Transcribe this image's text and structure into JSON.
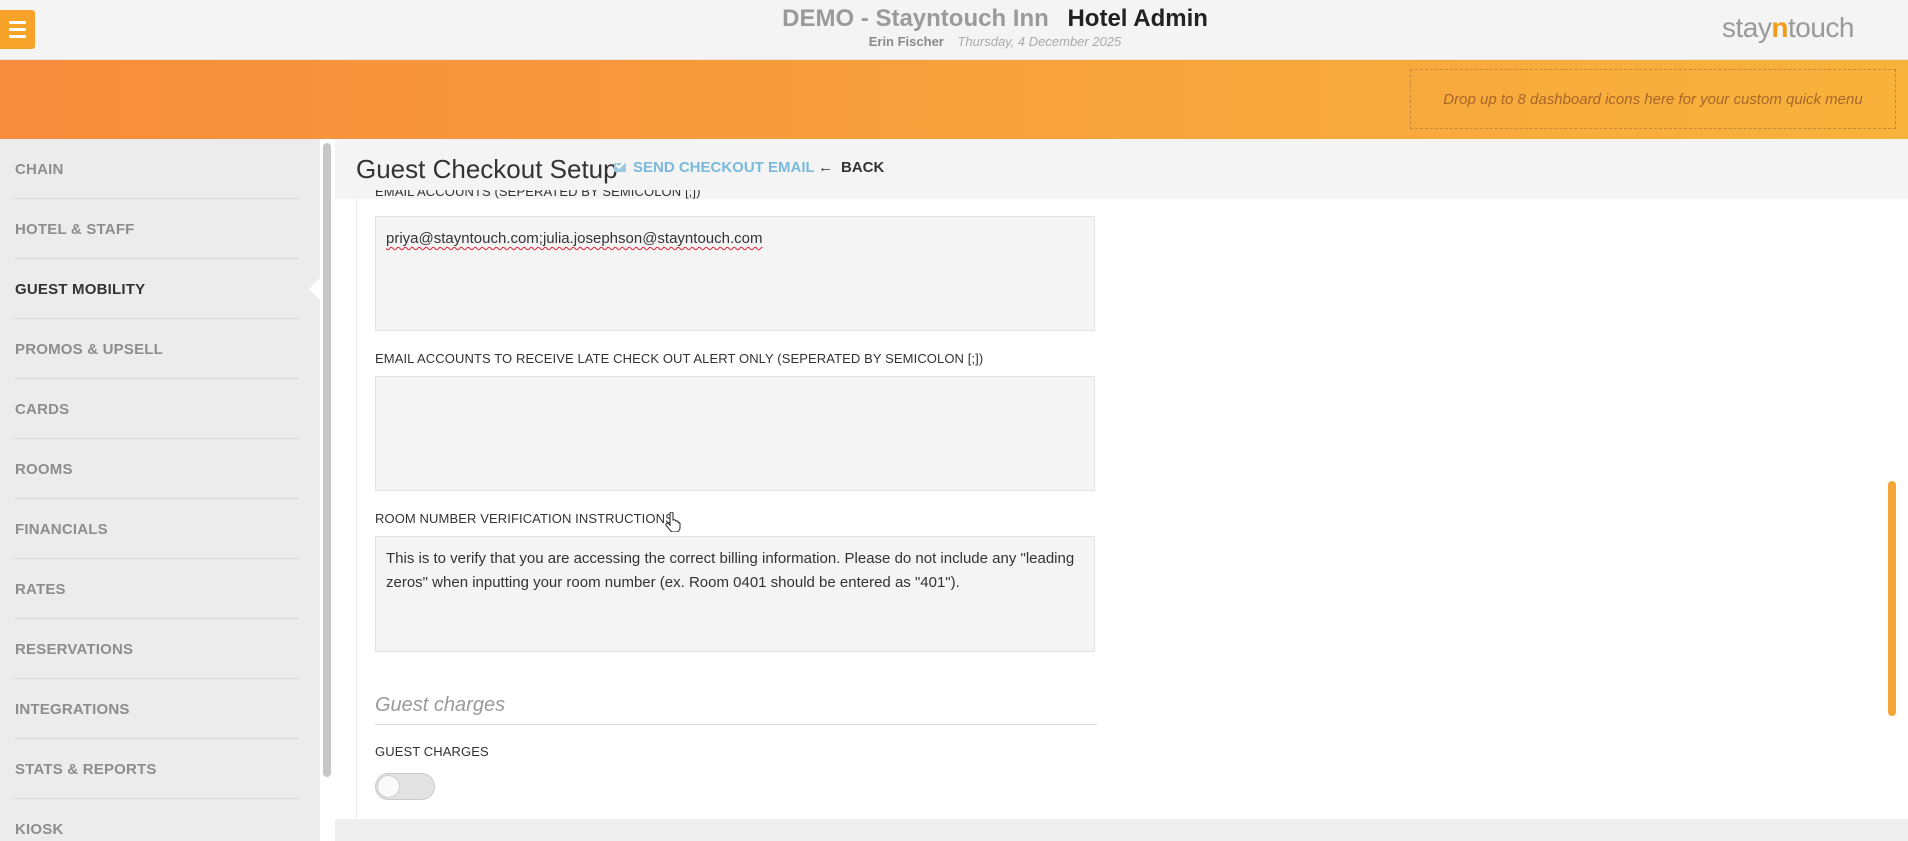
{
  "header": {
    "hotel_name": "DEMO - Stayntouch Inn",
    "app_name": "Hotel Admin",
    "user_name": "Erin Fischer",
    "date": "Thursday, 4 December 2025",
    "logo_prefix": "stay",
    "logo_n": "n",
    "logo_suffix": "touch",
    "menu_icon": "hamburger-icon"
  },
  "quick_menu": {
    "placeholder": "Drop up to 8 dashboard icons here for your custom quick menu"
  },
  "sidebar": {
    "items": [
      {
        "label": "CHAIN",
        "active": false
      },
      {
        "label": "HOTEL & STAFF",
        "active": false
      },
      {
        "label": "GUEST MOBILITY",
        "active": true
      },
      {
        "label": "PROMOS & UPSELL",
        "active": false
      },
      {
        "label": "CARDS",
        "active": false
      },
      {
        "label": "ROOMS",
        "active": false
      },
      {
        "label": "FINANCIALS",
        "active": false
      },
      {
        "label": "RATES",
        "active": false
      },
      {
        "label": "RESERVATIONS",
        "active": false
      },
      {
        "label": "INTEGRATIONS",
        "active": false
      },
      {
        "label": "STATS & REPORTS",
        "active": false
      },
      {
        "label": "KIOSK",
        "active": false
      }
    ]
  },
  "page": {
    "title": "Guest Checkout Setup",
    "send_email_label": "SEND CHECKOUT EMAIL",
    "back_label": "BACK",
    "back_icon": "arrow-left-icon",
    "email_icon": "envelope-icon"
  },
  "form": {
    "email_accounts_label": "EMAIL ACCOUNTS (SEPERATED BY SEMICOLON [;])",
    "email_accounts_value": "priya@stayntouch.com;julia.josephson@stayntouch.com",
    "late_checkout_label": "EMAIL ACCOUNTS TO RECEIVE LATE CHECK OUT ALERT ONLY (SEPERATED BY SEMICOLON [;])",
    "late_checkout_value": "",
    "room_verification_label": "ROOM NUMBER VERIFICATION INSTRUCTIONS",
    "room_verification_value": "This is to verify that you are accessing the correct billing information.  Please do not include any \"leading zeros\" when inputting your room number (ex. Room 0401 should be entered as \"401\").",
    "guest_charges_heading": "Guest charges",
    "guest_charges_label": "GUEST CHARGES",
    "guest_charges_enabled": false
  },
  "colors": {
    "accent_orange": "#f7a32a",
    "link_blue": "#79b9dc"
  }
}
